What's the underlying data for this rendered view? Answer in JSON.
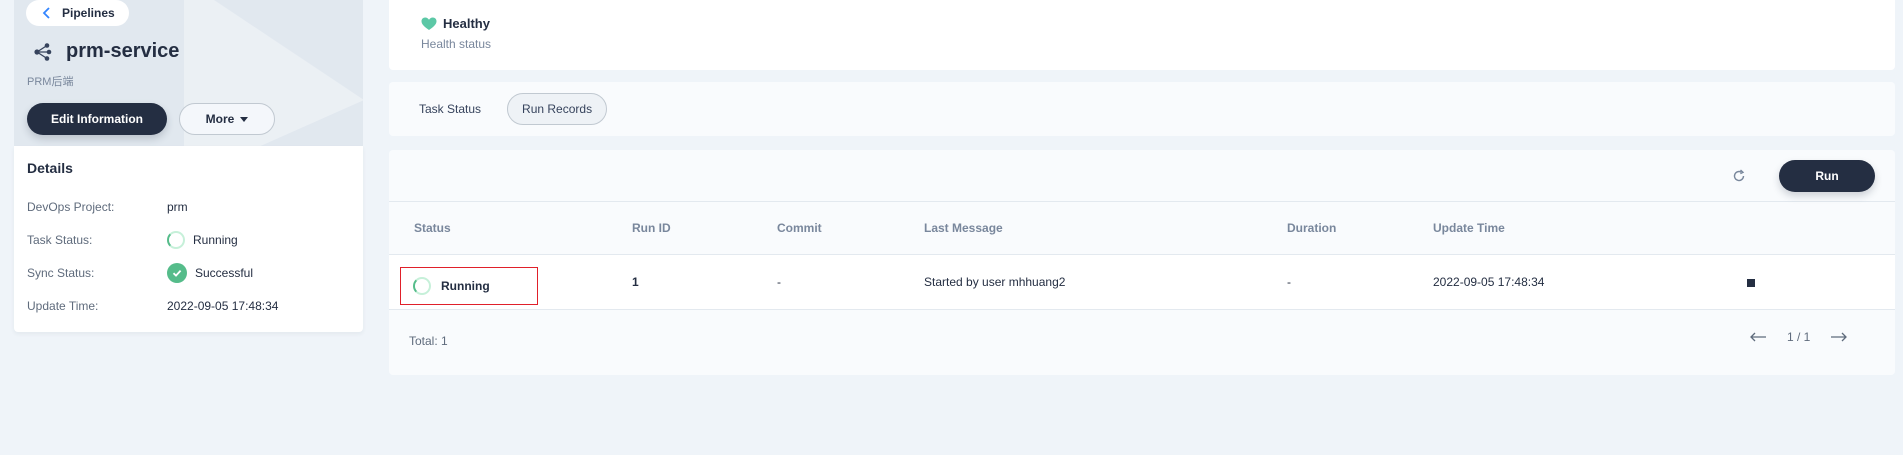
{
  "header": {
    "back_label": "Pipelines",
    "name": "prm-service",
    "description": "PRM后端",
    "edit_label": "Edit Information",
    "more_label": "More"
  },
  "details": {
    "title": "Details",
    "rows": [
      {
        "key": "DevOps Project:",
        "value": "prm"
      },
      {
        "key": "Task Status:",
        "value": "Running"
      },
      {
        "key": "Sync Status:",
        "value": "Successful"
      },
      {
        "key": "Update Time:",
        "value": "2022-09-05 17:48:34"
      }
    ]
  },
  "health": {
    "title": "Healthy",
    "subtitle": "Health status",
    "color": "#55bc8a"
  },
  "tabs": [
    {
      "label": "Task Status",
      "active": false
    },
    {
      "label": "Run Records",
      "active": true
    }
  ],
  "toolbar": {
    "run_label": "Run",
    "refresh_icon": "refresh-icon"
  },
  "table": {
    "columns": [
      "Status",
      "Run ID",
      "Commit",
      "Last Message",
      "Duration",
      "Update Time"
    ],
    "rows": [
      {
        "status": "Running",
        "run_id": "1",
        "commit": "-",
        "message": "Started by user mhhuang2",
        "duration": "-",
        "update_time": "2022-09-05 17:48:34"
      }
    ],
    "total": "Total: 1",
    "page": "1 / 1"
  },
  "colors": {
    "primary_dark": "#242e42",
    "success": "#55bc8a",
    "highlight": "#e0202a"
  }
}
